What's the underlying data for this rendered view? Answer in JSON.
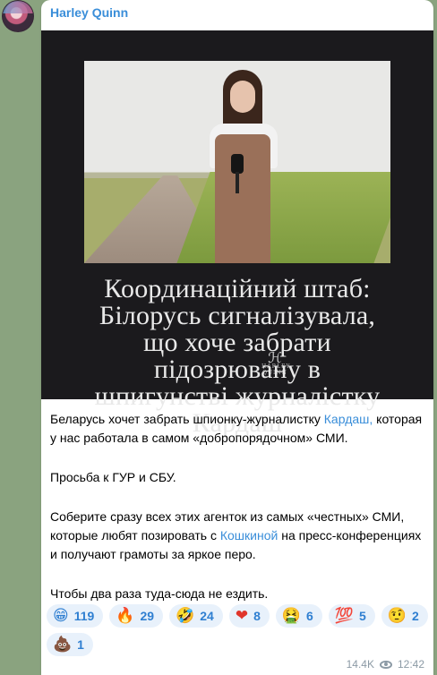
{
  "post": {
    "sender_name": "Harley Quinn",
    "image_headline": "Координаційний штаб: Білорусь сигналізувала, що хоче забрати підозрювану в шпигунстві журналістку Кардаш",
    "body": {
      "p1_before_link": "Беларусь хочет забрать шпионку-журналистку ",
      "p1_link": "Кардаш,",
      "p1_after": " которая у нас работала в самом «добропорядочном» СМИ.",
      "p2": "Просьба к ГУР и СБУ.",
      "p3_before_link": "Соберите сразу всех этих агенток из самых «честных» СМИ, которые любят позировать с ",
      "p3_link": "Кошкиной",
      "p3_after": " на пресс-конференциях и получают грамоты за яркое перо.",
      "p4": "Чтобы два раза туда-сюда не ездить."
    },
    "reactions": [
      {
        "emoji": "😁",
        "count": "119"
      },
      {
        "emoji": "🔥",
        "count": "29"
      },
      {
        "emoji": "🤣",
        "count": "24"
      },
      {
        "emoji": "❤",
        "count": "8"
      },
      {
        "emoji": "🤮",
        "count": "6"
      },
      {
        "emoji": "💯",
        "count": "5"
      },
      {
        "emoji": "🤨",
        "count": "2"
      },
      {
        "emoji": "💩",
        "count": "1"
      }
    ],
    "views": "14.4K",
    "time": "12:42"
  }
}
